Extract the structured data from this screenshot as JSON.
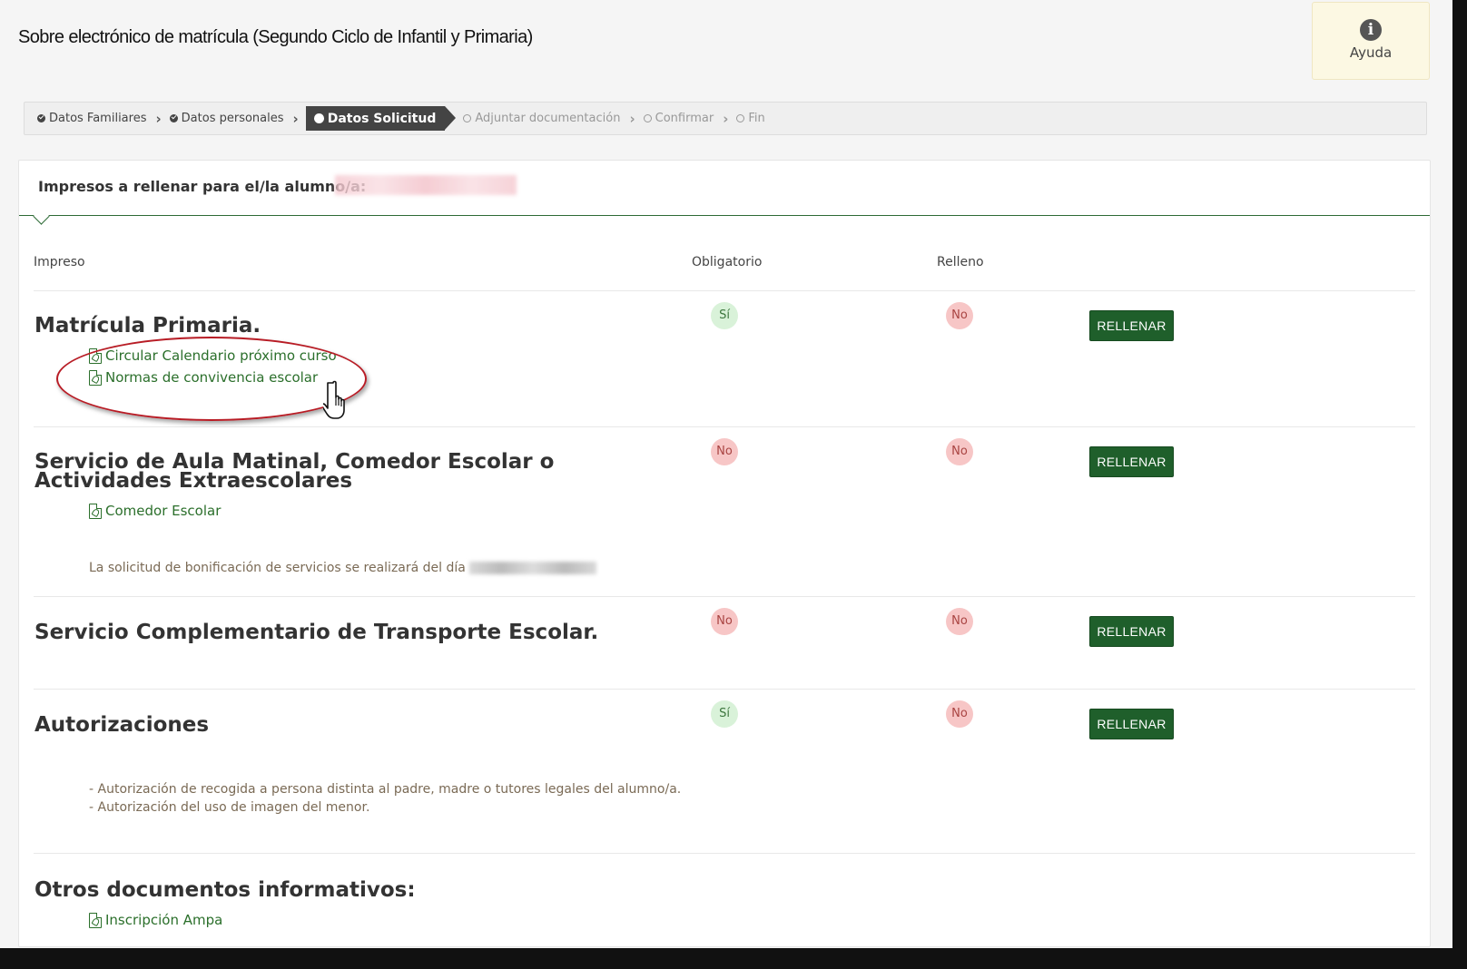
{
  "header": {
    "title": "Sobre electrónico de matrícula (Segundo Ciclo de Infantil y Primaria)",
    "help_label": "Ayuda",
    "help_icon": "info-circle-icon"
  },
  "steps": [
    {
      "label": "Datos Familiares",
      "state": "done"
    },
    {
      "label": "Datos personales",
      "state": "done"
    },
    {
      "label": "Datos Solicitud",
      "state": "active"
    },
    {
      "label": "Adjuntar documentación",
      "state": "pending"
    },
    {
      "label": "Confirmar",
      "state": "pending"
    },
    {
      "label": "Fin",
      "state": "pending"
    }
  ],
  "panel": {
    "heading": "Impresos a rellenar para el/la alumno/a:",
    "columns": {
      "impreso": "Impreso",
      "obligatorio": "Obligatorio",
      "relleno": "Relleno"
    }
  },
  "items": [
    {
      "title": "Matrícula Primaria.",
      "obligatorio": "Sí",
      "relleno": "No",
      "button": "RELLENAR",
      "links": [
        "Circular Calendario próximo curso",
        "Normas de convivencia escolar"
      ]
    },
    {
      "title_line1": "Servicio de Aula Matinal, Comedor Escolar o",
      "title_line2": "Actividades Extraescolares",
      "obligatorio": "No",
      "relleno": "No",
      "button": "RELLENAR",
      "links": [
        "Comedor Escolar"
      ],
      "note": "La solicitud de bonificación de servicios se realizará del día"
    },
    {
      "title": "Servicio Complementario de Transporte Escolar.",
      "obligatorio": "No",
      "relleno": "No",
      "button": "RELLENAR"
    },
    {
      "title": "Autorizaciones",
      "obligatorio": "Sí",
      "relleno": "No",
      "button": "RELLENAR",
      "notes": [
        "- Autorización de recogida a persona distinta al padre, madre o tutores legales del alumno/a.",
        "- Autorización del uso de imagen del menor."
      ]
    }
  ],
  "other_docs": {
    "title": "Otros documentos informativos:",
    "links": [
      "Inscripción Ampa"
    ]
  },
  "colors": {
    "accent_green": "#1f5f2b",
    "link_green": "#2b6f2b",
    "yes_badge": "#d9f2d9",
    "no_badge": "#f7c6c6",
    "callout_red": "#b81c25"
  }
}
